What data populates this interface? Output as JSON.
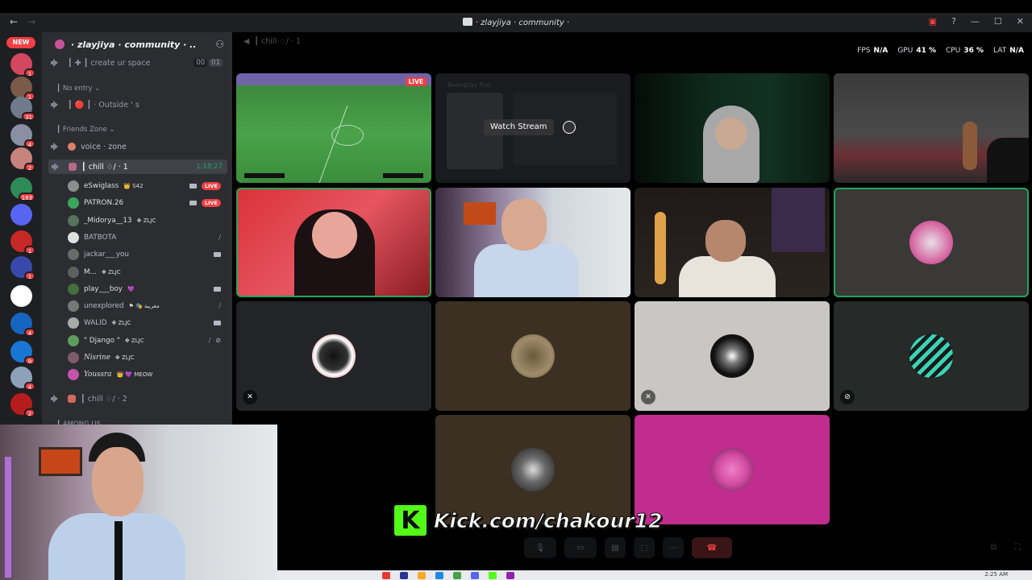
{
  "window": {
    "title": "· zlayjiya · community ·",
    "nav_back": "←",
    "nav_forward": "→",
    "controls": [
      "▣",
      "?",
      "—",
      "☐",
      "✕"
    ]
  },
  "server_rail": {
    "new_badge": "NEW",
    "servers": [
      {
        "name": "srv-1",
        "color": "#d3485f",
        "badge": "1"
      },
      {
        "name": "srv-2",
        "color": "#7a5a48",
        "badge": "1"
      },
      {
        "name": "srv-3",
        "color": "#6f7b8a",
        "badge": "31"
      },
      {
        "name": "srv-4",
        "color": "#8a8fa3",
        "badge": "4"
      },
      {
        "name": "srv-5",
        "color": "#c7837d",
        "badge": "2"
      },
      {
        "name": "srv-6",
        "color": "#2e8b57",
        "badge": "183"
      },
      {
        "name": "srv-7",
        "color": "#5865f2",
        "badge": ""
      },
      {
        "name": "srv-8",
        "color": "#c62828",
        "badge": "1"
      },
      {
        "name": "srv-9",
        "color": "#3949ab",
        "badge": "1"
      },
      {
        "name": "srv-10",
        "color": "#ffffff",
        "badge": ""
      },
      {
        "name": "srv-11",
        "color": "#1565c0",
        "badge": "4"
      },
      {
        "name": "srv-12",
        "color": "#1976d2",
        "badge": "9"
      },
      {
        "name": "srv-13",
        "color": "#8da2b8",
        "badge": "4"
      },
      {
        "name": "srv-14",
        "color": "#b71c1c",
        "badge": "2"
      }
    ]
  },
  "server": {
    "name": "· zlayjiya · community · ..",
    "channels": {
      "create": "┃ ✚ ┃ create ur space",
      "create_counts": [
        "00",
        "01"
      ],
      "no_entry_cat": "┃ No entry ⌄",
      "outside": "┃ 🔴 ┃ · Outside ' s",
      "friends_cat": "┃ Friends Zone ⌄",
      "voice_zone": "voice · zone",
      "chill1": "┃ chill ♢/ · 1",
      "chill1_time": "1:18:27",
      "chill2": "┃ chill ♢/ · 2",
      "among": "┃ AMONG US"
    },
    "members": [
      {
        "name": "eSwiglass",
        "tag": "👑 S42",
        "right": "live",
        "color": "#8d8d8d"
      },
      {
        "name": "PATRON.26",
        "tag": "",
        "right": "live",
        "color": "#3aa55c"
      },
      {
        "name": "_Midorya__13",
        "tag": "✥ ZLJC",
        "right": "",
        "color": "#56725a"
      },
      {
        "name": "BATBOTA",
        "tag": "",
        "right": "mute",
        "color": "#e0e0e0"
      },
      {
        "name": "jackar___you",
        "tag": "",
        "right": "cam",
        "color": "#6a6a6a"
      },
      {
        "name": "M...",
        "tag": "✥ ZLJC",
        "right": "",
        "color": "#5f5f5f"
      },
      {
        "name": "play___boy",
        "tag": "💜",
        "right": "cam",
        "color": "#446e3c"
      },
      {
        "name": "unexplored",
        "tag": "⚑ 🎭 مغربية",
        "right": "mute",
        "color": "#777"
      },
      {
        "name": "WALID",
        "tag": "✥ ZLJC",
        "right": "cam",
        "color": "#aaa"
      },
      {
        "name": "\" Django \"",
        "tag": "✥ ZLJC",
        "right": "mute2",
        "color": "#5d9c5a"
      },
      {
        "name": "Nisrine",
        "tag": "✥ ZLJC",
        "right": "",
        "color": "#7b5b6a"
      },
      {
        "name": "Youssra",
        "tag": "👑 💜 MEOW",
        "right": "",
        "color": "#c155a9"
      }
    ]
  },
  "main": {
    "channel_header": "┃ chill ♢/ · 1",
    "stats": {
      "fps_label": "FPS",
      "fps": "N/A",
      "gpu_label": "GPU",
      "gpu": "41 %",
      "cpu_label": "CPU",
      "cpu": "36 %",
      "lat_label": "LAT",
      "lat": "N/A"
    },
    "live_badge": "LIVE",
    "watch_stream": "Watch Stream",
    "stream_title_faint": "Teamplay Fun"
  },
  "watermark": {
    "letter": "K",
    "url": "Kick.com/chakour12"
  },
  "taskbar": {
    "clock": "2:25 AM"
  }
}
